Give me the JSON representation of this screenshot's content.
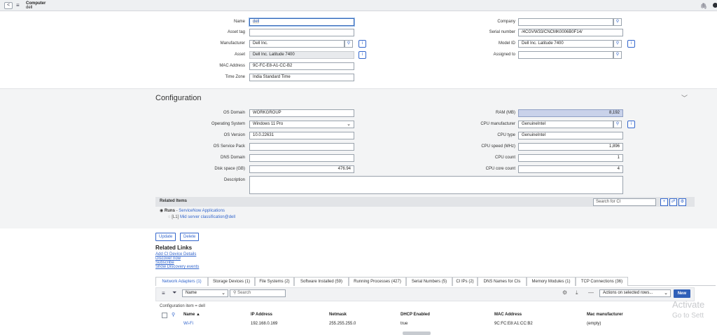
{
  "header": {
    "back": "<",
    "menu_icon": "hamburger-icon",
    "record_type": "Computer",
    "record_name": "dell"
  },
  "form": {
    "name": {
      "label": "Name",
      "value": "dell"
    },
    "asset_tag": {
      "label": "Asset tag",
      "value": ""
    },
    "manufacturer": {
      "label": "Manufacturer",
      "value": "Dell Inc."
    },
    "asset": {
      "label": "Asset",
      "value": "Dell Inc. Latitude 7400"
    },
    "mac_address": {
      "label": "MAC Address",
      "value": "9C-FC-E8-A1-CC-B2"
    },
    "time_zone": {
      "label": "Time Zone",
      "value": "India Standard Time"
    },
    "company": {
      "label": "Company",
      "value": ""
    },
    "serial_number": {
      "label": "Serial number",
      "value": "/4CGVW33/CNCMK0006B0F14/"
    },
    "model_id": {
      "label": "Model ID",
      "value": "Dell Inc. Latitude 7400"
    },
    "assigned_to": {
      "label": "Assigned to",
      "value": ""
    }
  },
  "config": {
    "title": "Configuration",
    "os_domain": {
      "label": "OS Domain",
      "value": "WORKGROUP"
    },
    "operating_system": {
      "label": "Operating System",
      "value": "Windows 11 Pro"
    },
    "os_version": {
      "label": "OS Version",
      "value": "10.0.22631"
    },
    "os_service_pack": {
      "label": "OS Service Pack",
      "value": ""
    },
    "dns_domain": {
      "label": "DNS Domain",
      "value": ""
    },
    "disk_space": {
      "label": "Disk space (GB)",
      "value": "476.94"
    },
    "description": {
      "label": "Description",
      "value": ""
    },
    "ram": {
      "label": "RAM (MB)",
      "value": "8,192"
    },
    "cpu_manufacturer": {
      "label": "CPU manufacturer",
      "value": "GenuineIntel"
    },
    "cpu_type": {
      "label": "CPU type",
      "value": "GenuineIntel"
    },
    "cpu_speed": {
      "label": "CPU speed (MHz)",
      "value": "1,896"
    },
    "cpu_count": {
      "label": "CPU count",
      "value": "1"
    },
    "cpu_core_count": {
      "label": "CPU core count",
      "value": "4"
    }
  },
  "related_items": {
    "title": "Related Items",
    "search_placeholder": "Search for CI",
    "runs_bold": "Runs",
    "runs_link": "ServiceNow Applications",
    "sub_prefix": "[L1]",
    "sub_link": "Mid server classification@dell"
  },
  "buttons": {
    "update": "Update",
    "delete": "Delete"
  },
  "related_links": {
    "title": "Related Links",
    "links": [
      "Add CI Device Details",
      "Discover now",
      "Subscribe",
      "Show Discovery events"
    ]
  },
  "tabs": [
    "Network Adapters (1)",
    "Storage Devices (1)",
    "File Systems (2)",
    "Software Installed (59)",
    "Running Processes (427)",
    "Serial Numbers (5)",
    "CI IPs (2)",
    "DNS Names for CIs",
    "Memory Modules (1)",
    "TCP Connections (36)"
  ],
  "list": {
    "field_select": "Name",
    "search_placeholder": "Search",
    "actions": "Actions on selected rows...",
    "new_button": "New",
    "filter_breadcrumb": "Configuration item = dell",
    "columns": [
      "Name ▲",
      "IP Address",
      "Netmask",
      "DHCP Enabled",
      "MAC Address",
      "Mac manufacturer"
    ],
    "row": [
      "Wi-Fi",
      "192.168.0.169",
      "255.255.255.0",
      "true",
      "9C:FC:E8:A1:CC:B2",
      "(empty)"
    ]
  },
  "watermark": {
    "line1": "Activate",
    "line2": "Go to Sett"
  },
  "colors": {
    "accent": "#3366cc",
    "highlight": "#c9d2ea",
    "new_button": "#2f5fb8"
  }
}
